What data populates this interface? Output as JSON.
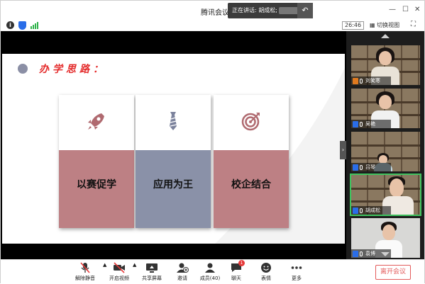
{
  "window": {
    "title": "腾讯会议",
    "speaking_label": "正在讲话: 胡成松;",
    "minimize": "—",
    "maximize": "☐",
    "close": "✕"
  },
  "infobar": {
    "timer": "26:46",
    "grid_view_label": "切换视图"
  },
  "slide": {
    "heading": "办学思路：",
    "cards": [
      {
        "label": "以赛促学",
        "icon": "rocket-icon",
        "color": "#bd8084"
      },
      {
        "label": "应用为王",
        "icon": "necktie-icon",
        "color": "#8a91a8"
      },
      {
        "label": "校企结合",
        "icon": "target-icon",
        "color": "#bd8084"
      }
    ]
  },
  "participants": [
    {
      "name": "刘笑寒"
    },
    {
      "name": "吴艳"
    },
    {
      "name": "吕琴"
    },
    {
      "name": "胡成松",
      "active": true
    },
    {
      "name": "袁博"
    }
  ],
  "toolbar": {
    "mute": "解除静音",
    "video": "开启视频",
    "share": "共享屏幕",
    "invite": "邀请",
    "members": "成员(40)",
    "chat": "聊天",
    "chat_badge": "1",
    "reactions": "表情",
    "more": "更多",
    "leave": "离开会议"
  },
  "colors": {
    "accent_red": "#e42b2b",
    "leave_red": "#e35b5b",
    "active_green": "#3fc35f"
  }
}
